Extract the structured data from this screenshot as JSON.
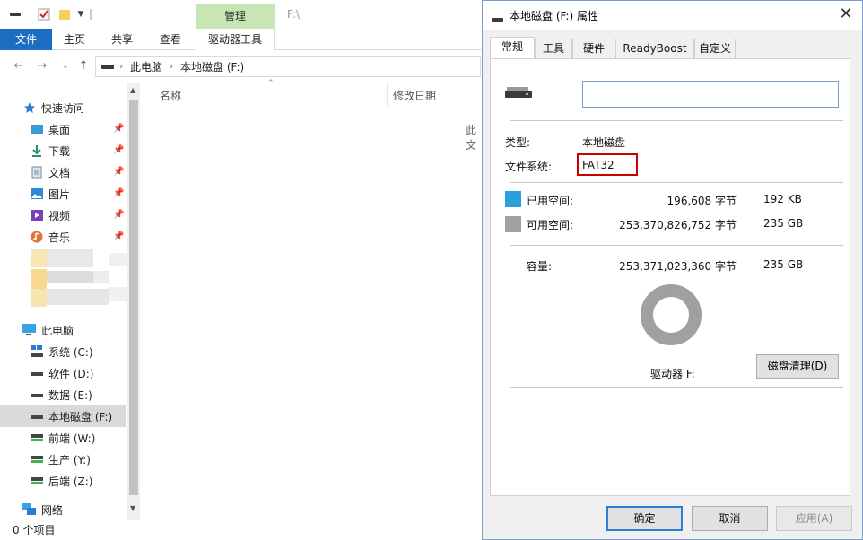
{
  "explorer": {
    "path_title": "F:\\",
    "ribbon": {
      "manage": "管理",
      "file": "文件",
      "home": "主页",
      "share": "共享",
      "view": "查看",
      "drive_tools": "驱动器工具"
    },
    "breadcrumb": [
      "此电脑",
      "本地磁盘 (F:)"
    ],
    "nav": {
      "quick_access": "快速访问",
      "desktop": "桌面",
      "downloads": "下载",
      "documents": "文档",
      "pictures": "图片",
      "videos": "视频",
      "music": "音乐",
      "this_pc": "此电脑",
      "drive_c": "系统 (C:)",
      "drive_d": "软件 (D:)",
      "drive_e": "数据 (E:)",
      "drive_f": "本地磁盘 (F:)",
      "drive_w": "前端 (W:)",
      "drive_y": "生产 (Y:)",
      "drive_z": "后端 (Z:)",
      "network": "网络"
    },
    "columns": {
      "name": "名称",
      "modified": "修改日期"
    },
    "empty_text": "此文",
    "status": "0 个项目"
  },
  "dialog": {
    "title": "本地磁盘 (F:) 属性",
    "tabs": [
      "常规",
      "工具",
      "硬件",
      "ReadyBoost",
      "自定义"
    ],
    "name_value": "",
    "type_label": "类型:",
    "type_value": "本地磁盘",
    "fs_label": "文件系统:",
    "fs_value": "FAT32",
    "used_label": "已用空间:",
    "used_bytes": "196,608 字节",
    "used_size": "192 KB",
    "free_label": "可用空间:",
    "free_bytes": "253,370,826,752 字节",
    "free_size": "235 GB",
    "capacity_label": "容量:",
    "capacity_bytes": "253,371,023,360 字节",
    "capacity_size": "235 GB",
    "drive_label": "驱动器 F:",
    "cleanup_button": "磁盘清理(D)",
    "ok_button": "确定",
    "cancel_button": "取消",
    "apply_button": "应用(A)",
    "used_fraction": 8e-07,
    "colors": {
      "used": "#2a9fd8",
      "free": "#a0a0a0",
      "highlight": "#cc0000"
    }
  }
}
